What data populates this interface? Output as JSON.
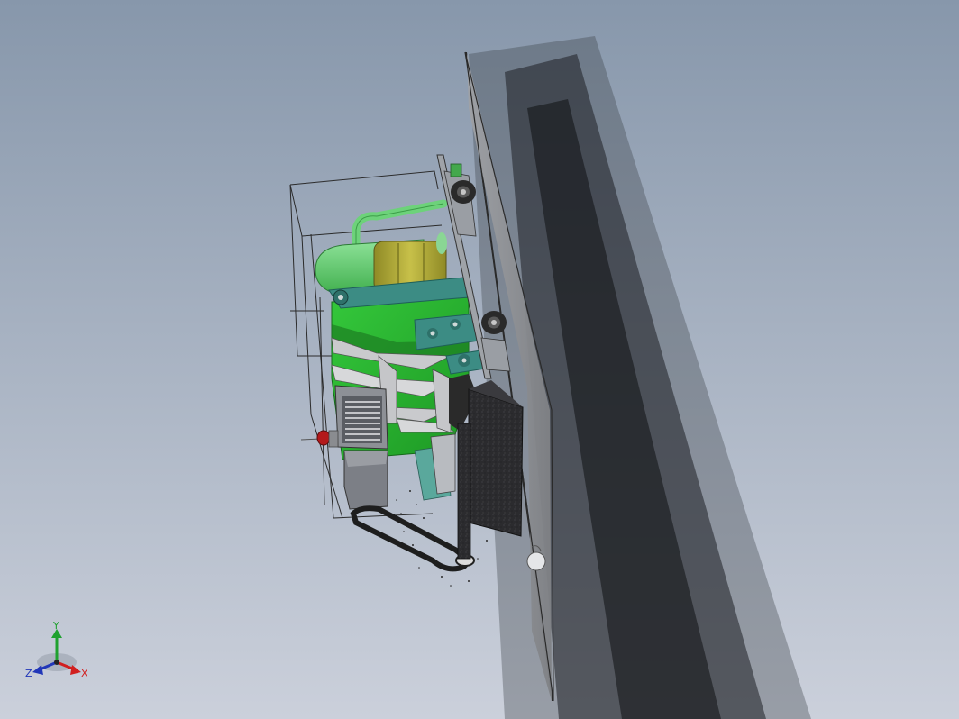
{
  "viewport": {
    "background": {
      "top": "#8797ab",
      "bottom": "#cbd0db"
    },
    "model": {
      "colors": {
        "panel": "#8e9093",
        "panel_edge": "#2a2a2a",
        "shadow": "#1b1c1f",
        "frame_line": "#2b2b2b",
        "body_green": "#2cc234",
        "body_green_dark": "#1a8f22",
        "tank_green": "#5fd36a",
        "pipe_green": "#6dd27a",
        "coil_gold": "#a9a338",
        "linkage_teal": "#3c8c84",
        "linkage_teal_dark": "#1f5f59",
        "grey_box": "#7c7f86",
        "dark_block": "#3a3a3e",
        "wheel": "#2a2a2a",
        "red_marker": "#b3191b"
      }
    },
    "triad": {
      "label_x": "X",
      "label_y": "Y",
      "label_z": "Z",
      "color_x": "#d11f1f",
      "color_y": "#1fa12f",
      "color_z": "#2136b8"
    }
  }
}
